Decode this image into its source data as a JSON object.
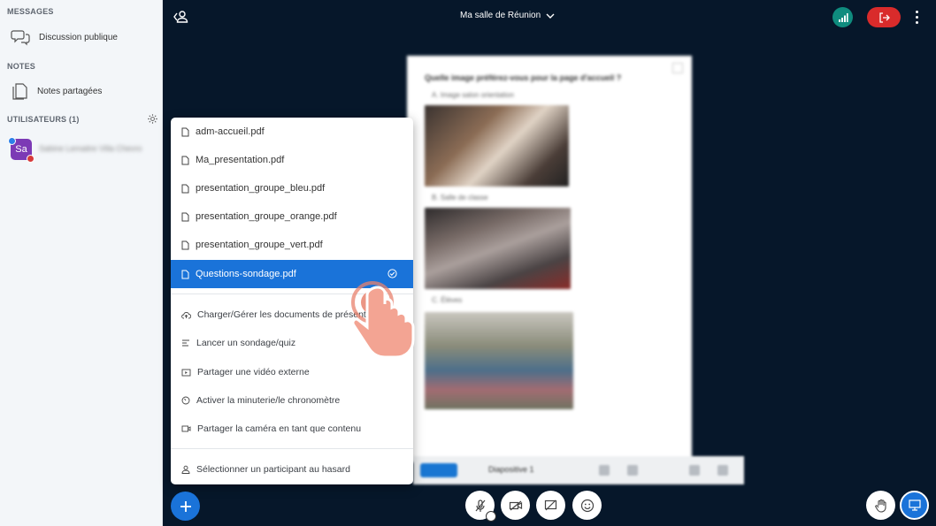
{
  "sidebar": {
    "messages_title": "MESSAGES",
    "public_chat": "Discussion publique",
    "notes_title": "NOTES",
    "shared_notes": "Notes partagées",
    "users_title": "UTILISATEURS (1)",
    "user": {
      "initials": "Sa",
      "name": "Sabine Lemaitre Villa Chevro"
    }
  },
  "topbar": {
    "room_title": "Ma salle de Réunion"
  },
  "menu": {
    "files": [
      {
        "label": "adm-accueil.pdf"
      },
      {
        "label": "Ma_presentation.pdf"
      },
      {
        "label": "presentation_groupe_bleu.pdf"
      },
      {
        "label": "presentation_groupe_orange.pdf"
      },
      {
        "label": "presentation_groupe_vert.pdf"
      },
      {
        "label": "Questions-sondage.pdf",
        "selected": true
      }
    ],
    "actions": [
      {
        "label": "Charger/Gérer les documents de présentation",
        "icon": "cloud-upload-icon"
      },
      {
        "label": "Lancer un sondage/quiz",
        "icon": "poll-icon"
      },
      {
        "label": "Partager une vidéo externe",
        "icon": "video-icon"
      },
      {
        "label": "Activer la minuterie/le chronomètre",
        "icon": "timer-icon"
      },
      {
        "label": "Partager la caméra en tant que contenu",
        "icon": "camera-icon"
      }
    ],
    "random_participant": "Sélectionner un participant au hasard"
  },
  "slide": {
    "question": "Quelle image préférez-vous pour la page d'accueil ?",
    "option_a": "A. Image salon orientation",
    "option_b": "B. Salle de classe",
    "option_c": "C. Élèves"
  },
  "slide_toolbar": {
    "slide_label": "Diapositive 1"
  },
  "colors": {
    "accent": "#1A73D9",
    "leave": "#D92B2B",
    "connection": "#0F8C7E",
    "background": "#06172A"
  }
}
